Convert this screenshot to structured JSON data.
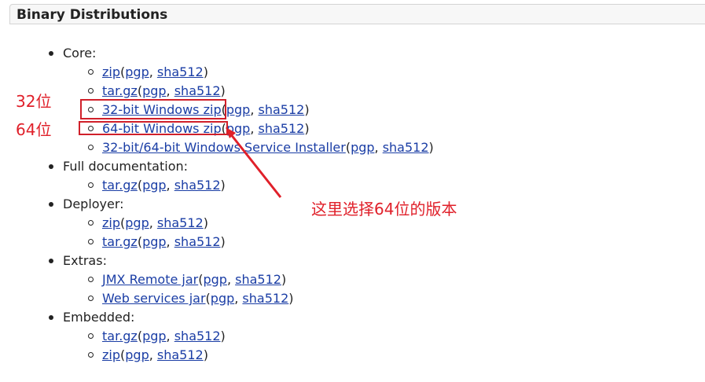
{
  "header": {
    "title": "Binary Distributions"
  },
  "sections": [
    {
      "label": "Core:",
      "items": [
        {
          "link": "zip",
          "pgp": "pgp",
          "sha": "sha512"
        },
        {
          "link": "tar.gz",
          "pgp": "pgp",
          "sha": "sha512"
        },
        {
          "link": "32-bit Windows zip",
          "pgp": "pgp",
          "sha": "sha512"
        },
        {
          "link": "64-bit Windows zip",
          "pgp": "pgp",
          "sha": "sha512"
        },
        {
          "link": "32-bit/64-bit Windows Service Installer",
          "pgp": "pgp",
          "sha": "sha512"
        }
      ]
    },
    {
      "label": "Full documentation:",
      "items": [
        {
          "link": "tar.gz",
          "pgp": "pgp",
          "sha": "sha512"
        }
      ]
    },
    {
      "label": "Deployer:",
      "items": [
        {
          "link": "zip",
          "pgp": "pgp",
          "sha": "sha512"
        },
        {
          "link": "tar.gz",
          "pgp": "pgp",
          "sha": "sha512"
        }
      ]
    },
    {
      "label": "Extras:",
      "items": [
        {
          "link": "JMX Remote jar",
          "pgp": "pgp",
          "sha": "sha512"
        },
        {
          "link": "Web services jar",
          "pgp": "pgp",
          "sha": "sha512"
        }
      ]
    },
    {
      "label": "Embedded:",
      "items": [
        {
          "link": "tar.gz",
          "pgp": "pgp",
          "sha": "sha512"
        },
        {
          "link": "zip",
          "pgp": "pgp",
          "sha": "sha512"
        }
      ]
    }
  ],
  "punct": {
    "open": "(",
    "comma": ", ",
    "close": ")"
  },
  "annotations": {
    "label_32": "32位",
    "label_64": "64位",
    "note": "这里选择64位的版本",
    "color": "#e0202a"
  }
}
